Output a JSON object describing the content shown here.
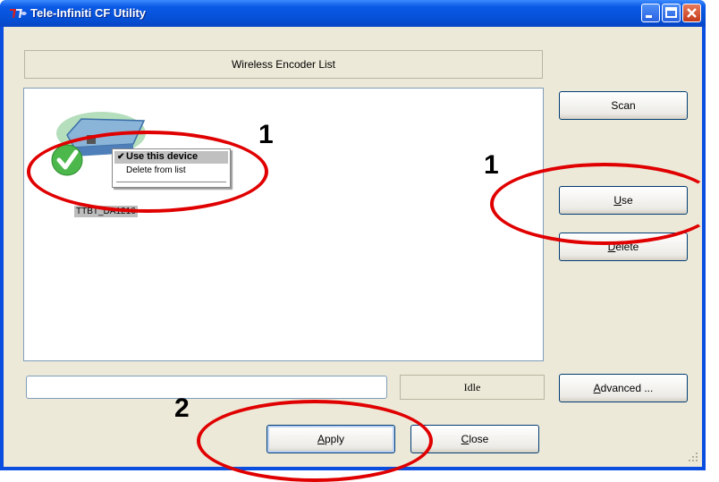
{
  "window": {
    "title": "Tele-Infiniti CF Utility"
  },
  "header": {
    "title": "Wireless Encoder List"
  },
  "device": {
    "label": "TTBT_DA1216"
  },
  "context_menu": {
    "items": [
      {
        "label": "Use this device",
        "checked": true
      },
      {
        "label": "Delete from list"
      }
    ]
  },
  "buttons": {
    "scan": "Scan",
    "use": {
      "u": "U",
      "rest": "se"
    },
    "delete": {
      "u": "D",
      "rest": "elete"
    },
    "advanced": {
      "u": "A",
      "rest": "dvanced ..."
    },
    "apply": {
      "u": "A",
      "rest": "pply"
    },
    "close": {
      "u": "C",
      "rest": "lose"
    }
  },
  "status": {
    "text": "Idle"
  },
  "annotations": {
    "num1": "1",
    "num2": "1",
    "num3": "2"
  },
  "colors": {
    "annotation": "#e00000",
    "titlebar": "#0550d6"
  }
}
